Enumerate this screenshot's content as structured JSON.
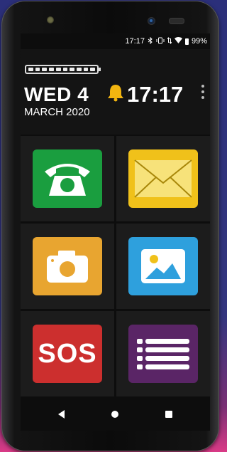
{
  "status_bar": {
    "time": "17:17",
    "battery_percent": "99%",
    "icons": [
      "bluetooth-icon",
      "vibrate-icon",
      "data-arrows-icon",
      "wifi-icon",
      "battery-icon"
    ]
  },
  "header": {
    "battery_level": 1.0,
    "day": "WED 4",
    "month": "MARCH 2020",
    "clock": "17:17",
    "icons": [
      "alarm-bell-icon",
      "more-options-icon"
    ]
  },
  "tiles": [
    {
      "name": "phone",
      "icon": "telephone-icon",
      "color": "#1a9e3f"
    },
    {
      "name": "messages",
      "icon": "envelope-icon",
      "color": "#f0c11a"
    },
    {
      "name": "camera",
      "icon": "camera-icon",
      "color": "#e8a530"
    },
    {
      "name": "gallery",
      "icon": "picture-icon",
      "color": "#2ea0dd"
    },
    {
      "name": "sos",
      "label": "SOS",
      "color": "#cc2f2e"
    },
    {
      "name": "menu",
      "icon": "list-icon",
      "color": "#5a2566"
    }
  ],
  "navigation": {
    "icons": [
      "back-icon",
      "home-icon",
      "recents-icon"
    ]
  }
}
